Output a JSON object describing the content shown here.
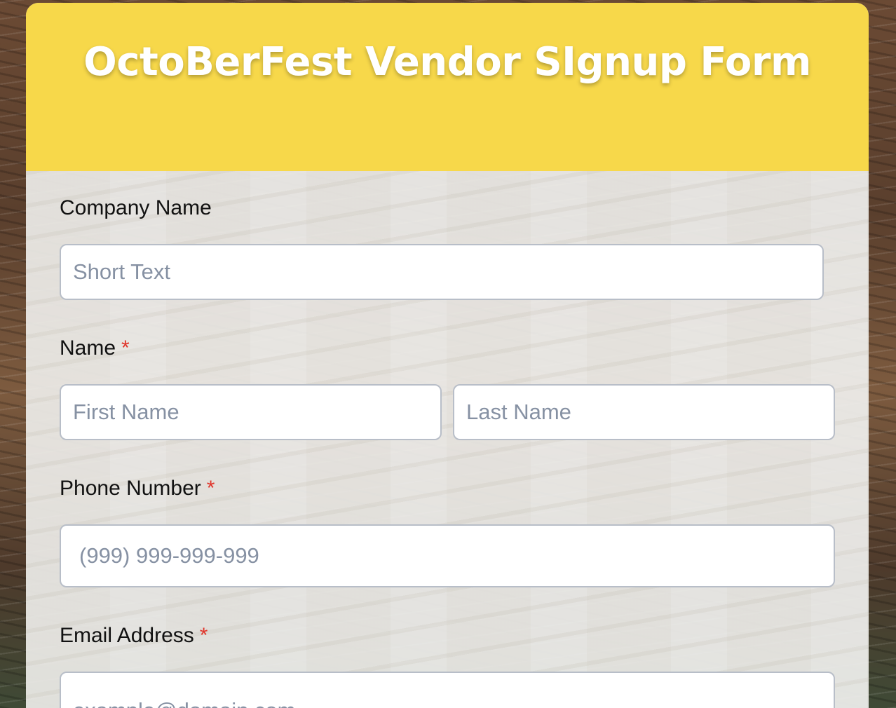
{
  "form": {
    "title": "OctoBerFest Vendor SIgnup Form",
    "colors": {
      "header": "#f7d84a",
      "required": "#e0352b",
      "placeholder": "#8691a3"
    },
    "fields": {
      "company_name": {
        "label": "Company Name",
        "placeholder": "Short Text",
        "value": ""
      },
      "name": {
        "label": "Name",
        "required": "*",
        "first_placeholder": "First Name",
        "last_placeholder": "Last Name"
      },
      "phone": {
        "label": "Phone Number",
        "required": "*",
        "placeholder": "(999) 999-999-999"
      },
      "email": {
        "label": "Email Address",
        "required": "*",
        "placeholder": "example@domain.com"
      }
    }
  }
}
